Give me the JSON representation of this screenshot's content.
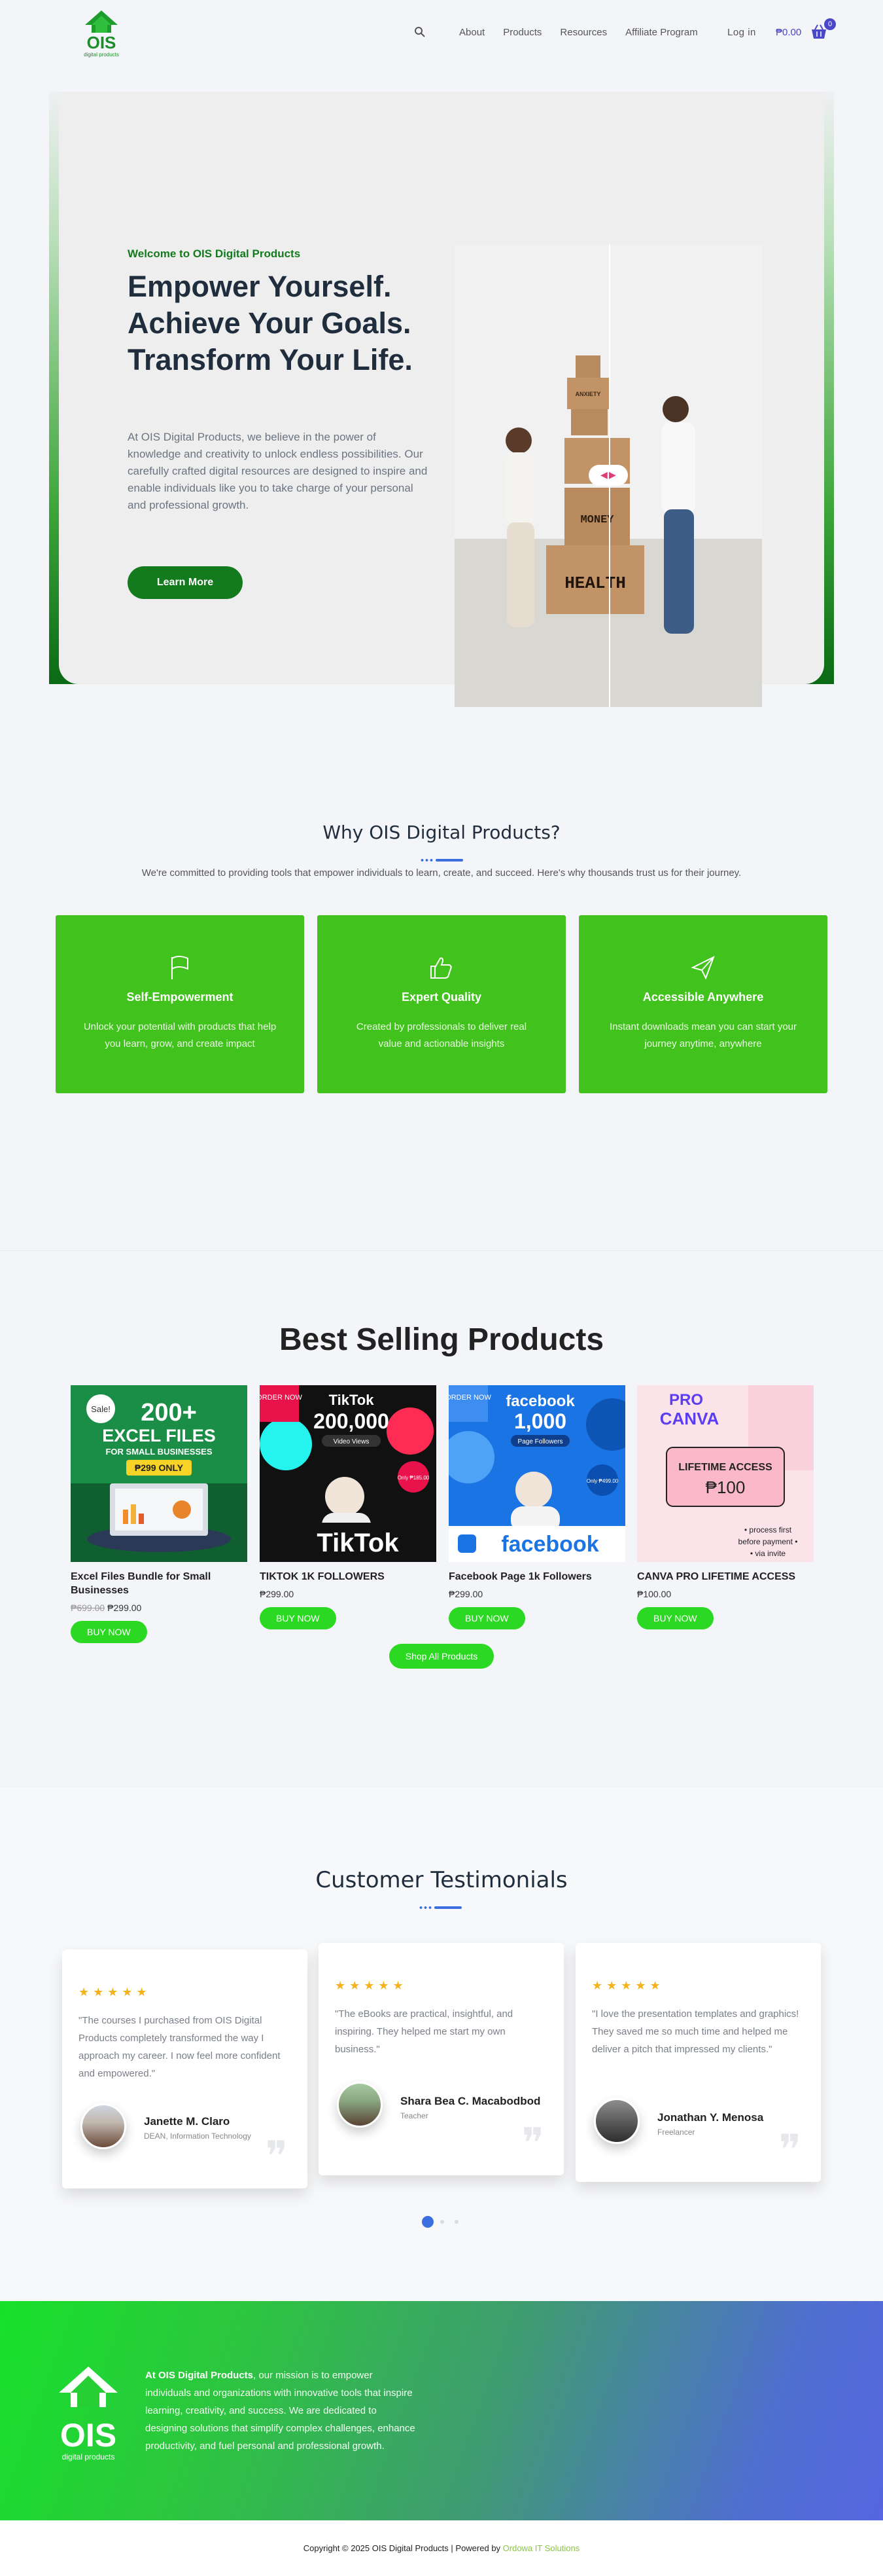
{
  "header": {
    "logo_text": "OIS",
    "logo_sub": "digital products",
    "nav": [
      "About",
      "Products",
      "Resources",
      "Affiliate Program"
    ],
    "login": "Log in",
    "cart_total": "₱0.00",
    "cart_count": "0"
  },
  "hero": {
    "eyebrow": "Welcome to OIS Digital Products",
    "title": "Empower Yourself. Achieve Your Goals. Transform Your Life.",
    "text": "At OIS Digital Products, we believe in the power of knowledge and creativity to unlock endless possibilities. Our carefully crafted digital resources are designed to inspire and enable individuals like you to take charge of your personal and professional growth.",
    "button": "Learn More",
    "image_boxes": [
      "MONEY",
      "HEALTH",
      "ANXIETY"
    ]
  },
  "why": {
    "title": "Why OIS Digital Products?",
    "subtitle": "We're committed to providing tools that empower individuals to learn, create, and succeed. Here's why thousands trust us for their journey.",
    "features": [
      {
        "icon": "flag-icon",
        "title": "Self-Empowerment",
        "desc": "Unlock your potential with products that help you learn, grow, and create impact"
      },
      {
        "icon": "thumbs-up-icon",
        "title": "Expert Quality",
        "desc": "Created by professionals to deliver real value and actionable insights"
      },
      {
        "icon": "paper-plane-icon",
        "title": "Accessible Anywhere",
        "desc": "Instant downloads mean you can start your journey anytime, anywhere"
      }
    ]
  },
  "best": {
    "title": "Best Selling Products",
    "products": [
      {
        "name": "Excel Files Bundle for Small Businesses",
        "old_price": "₱699.00",
        "price": "₱299.00",
        "button": "BUY NOW",
        "img": {
          "badge": "Sale!",
          "line1": "200+",
          "line2": "EXCEL FILES",
          "line3": "FOR SMALL BUSINESSES",
          "tag": "₱299 ONLY"
        }
      },
      {
        "name": "TIKTOK 1K FOLLOWERS",
        "old_price": "",
        "price": "₱299.00",
        "button": "BUY NOW",
        "img": {
          "order": "ORDER NOW",
          "brand": "TikTok",
          "count": "200,000",
          "sub": "Video Views",
          "only": "Only ₱185.00",
          "logo": "TikTok"
        }
      },
      {
        "name": "Facebook Page 1k Followers",
        "old_price": "",
        "price": "₱299.00",
        "button": "BUY NOW",
        "img": {
          "order": "ORDER NOW",
          "brand": "facebook",
          "count": "1,000",
          "sub": "Page Followers",
          "only": "Only ₱499.00",
          "logo": "facebook"
        }
      },
      {
        "name": "CANVA PRO LIFETIME ACCESS",
        "old_price": "",
        "price": "₱100.00",
        "button": "BUY NOW",
        "img": {
          "line1": "PRO",
          "line2": "CANVA",
          "box1": "LIFETIME ACCESS",
          "box2": "₱100",
          "b1": "• process first",
          "b2": "before payment •",
          "b3": "• via invite"
        }
      }
    ],
    "shop_all": "Shop All Products"
  },
  "testimonials": {
    "title": "Customer Testimonials",
    "items": [
      {
        "stars": "★★★★★",
        "quote": "\"The courses I purchased from OIS Digital Products completely transformed the way I approach my career. I now feel more confident and empowered.\"",
        "name": "Janette M. Claro",
        "role": "DEAN, Information Technology"
      },
      {
        "stars": "★★★★★",
        "quote": "\"The eBooks are practical, insightful, and inspiring. They helped me start my own business.\"",
        "name": "Shara Bea C. Macabodbod",
        "role": "Teacher"
      },
      {
        "stars": "★★★★★",
        "quote": "\"I love the presentation templates and graphics! They saved me so much time and helped me deliver a pitch that impressed my clients.\"",
        "name": "Jonathan Y. Menosa",
        "role": "Freelancer"
      }
    ]
  },
  "footer": {
    "brand": "At OIS Digital Products",
    "text": ", our mission is to empower individuals and organizations with innovative tools that inspire learning, creativity, and success. We are dedicated to designing solutions that simplify complex challenges, enhance productivity, and fuel personal and professional growth.",
    "logo_text": "OIS",
    "logo_sub": "digital products",
    "socials": [
      "instagram-icon",
      "facebook-icon",
      "youtube-icon",
      "twitter-icon"
    ],
    "copyright": "Copyright © 2025 OIS Digital Products | Powered by ",
    "powered_by": "Ordowa IT Solutions"
  },
  "colors": {
    "green": "#41c21c",
    "dark_green": "#137a1e",
    "accent_blue": "#3b6fe0",
    "cart": "#4b47c9"
  }
}
